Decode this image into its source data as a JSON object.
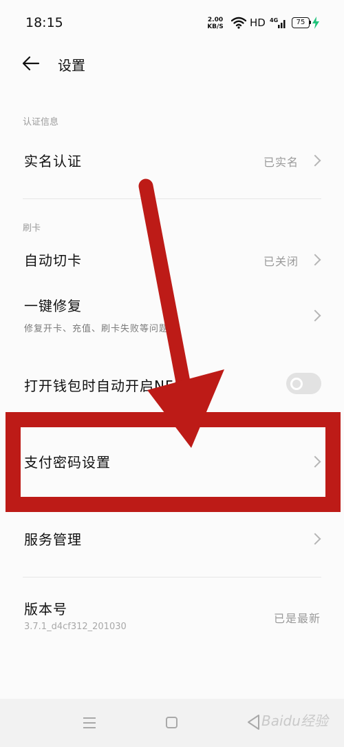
{
  "status_bar": {
    "time": "18:15",
    "speed_value": "2.00",
    "speed_unit": "KB/S",
    "hd": "HD",
    "network": "4G",
    "battery": "75"
  },
  "header": {
    "back_icon": "arrow-left-icon",
    "title": "设置"
  },
  "sections": {
    "auth": {
      "label": "认证信息",
      "real_name": {
        "title": "实名认证",
        "value": "已实名"
      }
    },
    "card": {
      "label": "刷卡",
      "auto_switch": {
        "title": "自动切卡",
        "value": "已关闭"
      },
      "one_key_fix": {
        "title": "一键修复",
        "subtitle": "修复开卡、充值、刷卡失败等问题"
      },
      "nfc": {
        "title": "打开钱包时自动开启NFC",
        "enabled": false
      }
    },
    "payment_password": {
      "title": "支付密码设置"
    },
    "service": {
      "title": "服务管理"
    },
    "version": {
      "title": "版本号",
      "subtitle": "3.7.1_d4cf312_201030",
      "value": "已是最新"
    }
  },
  "annotation": {
    "color": "#bd1b17"
  },
  "navbar": {
    "menu_icon": "menu-icon",
    "home_icon": "square-home-icon",
    "back_icon": "triangle-back-icon"
  },
  "watermark": {
    "text": "Baidu经验"
  }
}
